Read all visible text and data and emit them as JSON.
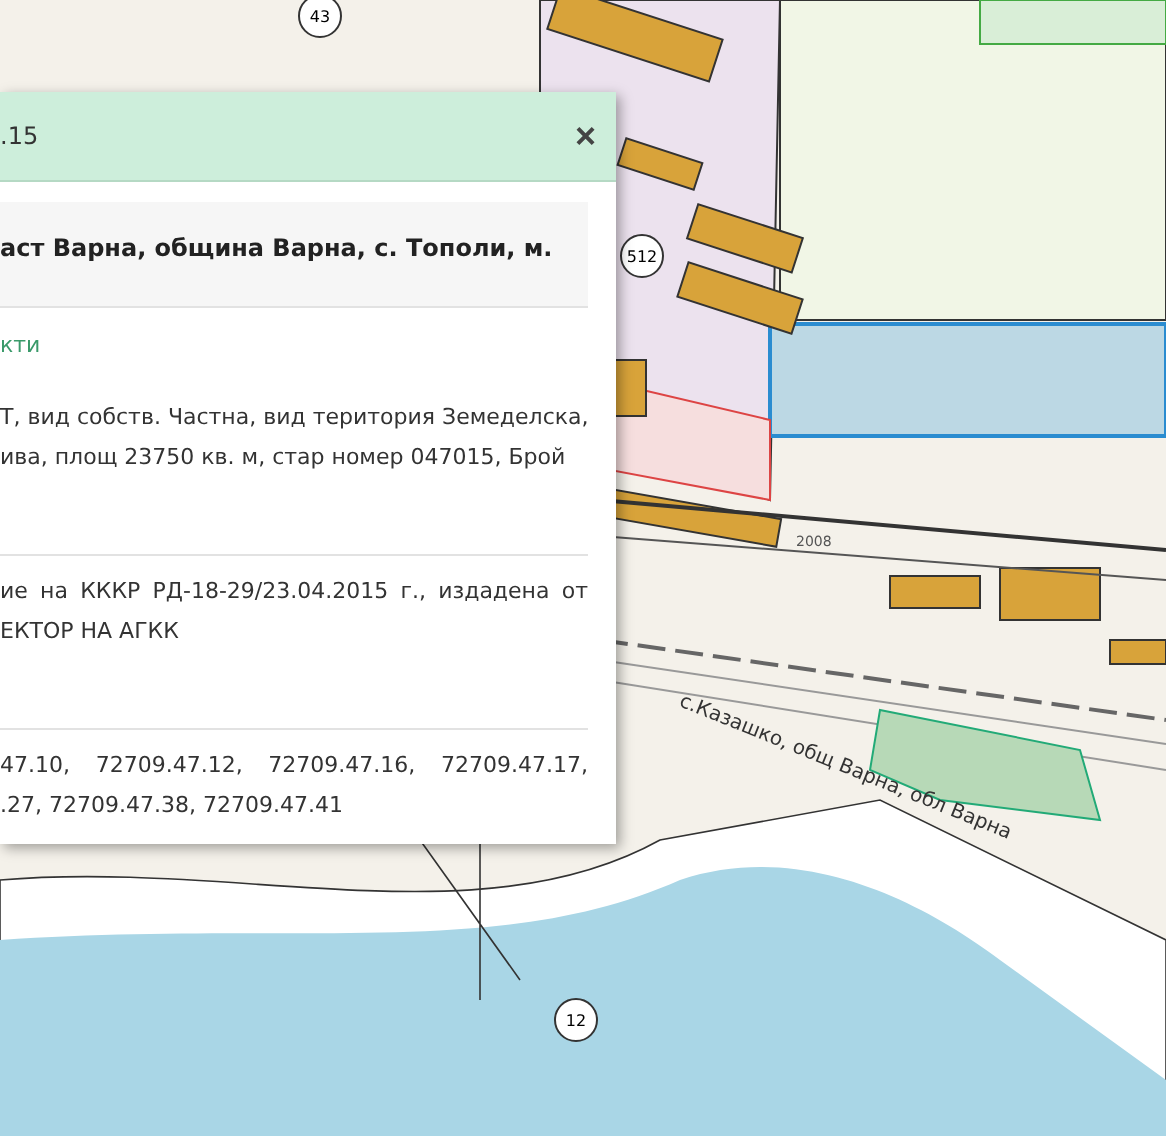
{
  "map": {
    "labels": [
      {
        "kind": "circle",
        "text": "43"
      },
      {
        "kind": "circle",
        "text": "512"
      },
      {
        "kind": "circle",
        "text": "12"
      },
      {
        "kind": "road",
        "text": "2008"
      },
      {
        "kind": "place",
        "text": "с.Казашко, общ Варна, обл Варна"
      }
    ]
  },
  "popup": {
    "title": ".15",
    "close": "×",
    "address": "аст Варна, община Варна, с. Тополи, м.",
    "section_heading": "кти",
    "blocks": [
      {
        "lines": [
          "Т, вид собств. Частна, вид територия Земеделска,",
          "ива, площ 23750 кв. м, стар номер 047015, Брой"
        ]
      },
      {
        "lines": [
          "ие на КККР РД-18-29/23.04.2015 г., издадена от",
          "ЕКТОР НА АГКК"
        ]
      },
      {
        "lines": [
          "47.10, 72709.47.12, 72709.47.16, 72709.47.17,",
          ".27, 72709.47.38, 72709.47.41"
        ]
      }
    ]
  }
}
